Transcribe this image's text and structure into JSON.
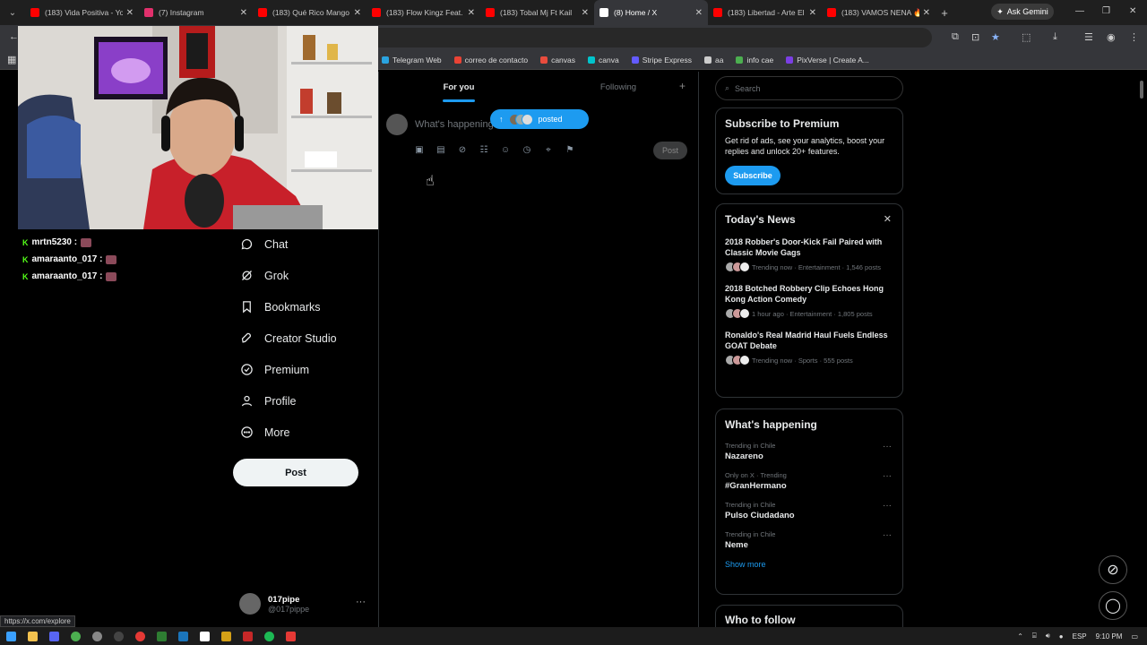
{
  "browser": {
    "tabs": [
      {
        "title": "(183) Vida Positiva - Yo",
        "color": "#ff0000",
        "active": false
      },
      {
        "title": "(7) Instagram",
        "color": "#e1306c",
        "active": false
      },
      {
        "title": "(183) Qué Rico Mango",
        "color": "#ff0000",
        "active": false
      },
      {
        "title": "(183) Flow Kingz Feat.",
        "color": "#ff0000",
        "active": false
      },
      {
        "title": "(183) Tobal Mj Ft Kail",
        "color": "#ff0000",
        "active": false
      },
      {
        "title": "(8) Home / X",
        "color": "#ffffff",
        "active": true
      },
      {
        "title": "(183) Libertad - Arte El",
        "color": "#ff0000",
        "active": false
      },
      {
        "title": "(183) VAMOS NENA 🔥",
        "color": "#ff0000",
        "active": false
      }
    ],
    "gemini_label": "Ask Gemini",
    "bookmarks": [
      {
        "label": "Telegram Web",
        "color": "#2aa3e0"
      },
      {
        "label": "correo de contacto",
        "color": "#ea4335"
      },
      {
        "label": "canvas",
        "color": "#e94c3d"
      },
      {
        "label": "canva",
        "color": "#00c4cc"
      },
      {
        "label": "Stripe Express",
        "color": "#635bff"
      },
      {
        "label": "aa",
        "color": "#cccccc"
      },
      {
        "label": "info cae",
        "color": "#4caf50"
      },
      {
        "label": "PixVerse | Create A...",
        "color": "#7b3fe4"
      }
    ],
    "status_url": "https://x.com/explore"
  },
  "stream_chat": [
    {
      "user": "mrtn5230 :",
      "color": "#ffffff"
    },
    {
      "user": "amaraanto_017 :",
      "color": "#ffffff"
    },
    {
      "user": "amaraanto_017 :",
      "color": "#ffffff"
    }
  ],
  "nav": [
    {
      "label": "Chat",
      "icon": "chat-icon"
    },
    {
      "label": "Grok",
      "icon": "grok-icon"
    },
    {
      "label": "Bookmarks",
      "icon": "bookmark-icon"
    },
    {
      "label": "Creator Studio",
      "icon": "rocket-icon"
    },
    {
      "label": "Premium",
      "icon": "verified-icon"
    },
    {
      "label": "Profile",
      "icon": "person-icon"
    },
    {
      "label": "More",
      "icon": "more-circle-icon"
    }
  ],
  "post_button": "Post",
  "account": {
    "name": "017pipe",
    "handle": "@017pippe"
  },
  "feed": {
    "tabs": [
      "For you",
      "Following"
    ],
    "composer_placeholder": "What's happening",
    "posted_label": "posted",
    "post_label": "Post"
  },
  "sidebar": {
    "search_placeholder": "Search",
    "premium": {
      "title": "Subscribe to Premium",
      "text": "Get rid of ads, see your analytics, boost your replies and unlock 20+ features.",
      "button": "Subscribe"
    },
    "news": {
      "title": "Today's News",
      "items": [
        {
          "title": "2018 Robber's Door-Kick Fail Paired with Classic Movie Gags",
          "meta": "Trending now · Entertainment · 1,546 posts"
        },
        {
          "title": "2018 Botched Robbery Clip Echoes Hong Kong Action Comedy",
          "meta": "1 hour ago · Entertainment · 1,805 posts"
        },
        {
          "title": "Ronaldo's Real Madrid Haul Fuels Endless GOAT Debate",
          "meta": "Trending now · Sports · 555 posts"
        }
      ]
    },
    "happening": {
      "title": "What's happening",
      "items": [
        {
          "context": "Trending in Chile",
          "name": "Nazareno"
        },
        {
          "context": "Only on X · Trending",
          "name": "#GranHermano"
        },
        {
          "context": "Trending in Chile",
          "name": "Pulso Ciudadano"
        },
        {
          "context": "Trending in Chile",
          "name": "Neme"
        }
      ],
      "show_more": "Show more"
    },
    "who_to_follow": "Who to follow"
  },
  "taskbar": {
    "lang": "ESP",
    "time": "9:10 PM"
  }
}
